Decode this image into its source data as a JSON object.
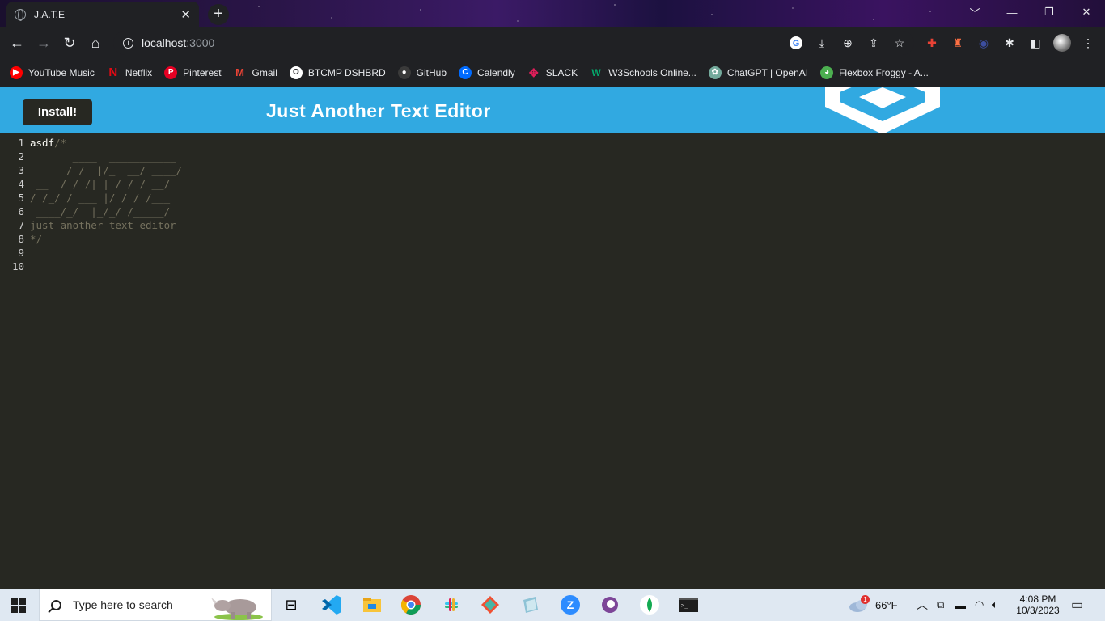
{
  "browser": {
    "tab_title": "J.A.T.E",
    "tab_close": "✕",
    "new_tab": "+",
    "url_host": "localhost",
    "url_port": ":3000",
    "window_controls": [
      "﹀",
      "—",
      "❐",
      "✕"
    ]
  },
  "bookmarks": [
    {
      "label": "YouTube Music",
      "icon": "youtube-music-icon",
      "color": "#ff0000"
    },
    {
      "label": "Netflix",
      "icon": "netflix-icon",
      "color": "#e50914"
    },
    {
      "label": "Pinterest",
      "icon": "pinterest-icon",
      "color": "#e60023"
    },
    {
      "label": "Gmail",
      "icon": "gmail-icon",
      "color": "#ea4335"
    },
    {
      "label": "BTCMP DSHBRD",
      "icon": "bootcamp-icon",
      "color": "#ffffff"
    },
    {
      "label": "GitHub",
      "icon": "github-icon",
      "color": "#24292e"
    },
    {
      "label": "Calendly",
      "icon": "calendly-icon",
      "color": "#006bff"
    },
    {
      "label": "SLACK",
      "icon": "slack-icon",
      "color": "#4a154b"
    },
    {
      "label": "W3Schools Online...",
      "icon": "w3schools-icon",
      "color": "#04aa6d"
    },
    {
      "label": "ChatGPT | OpenAI",
      "icon": "chatgpt-icon",
      "color": "#74aa9c"
    },
    {
      "label": "Flexbox Froggy - A...",
      "icon": "froggy-icon",
      "color": "#4caf50"
    }
  ],
  "app": {
    "install_label": "Install!",
    "title": "Just Another Text Editor",
    "accent": "#31a9e1"
  },
  "editor": {
    "lines": [
      {
        "n": "1",
        "plain": "asdf",
        "comment": "/*"
      },
      {
        "n": "2",
        "plain": "",
        "comment": "       ____  ___________"
      },
      {
        "n": "3",
        "plain": "",
        "comment": "      / /  |/_  __/ ____/"
      },
      {
        "n": "4",
        "plain": "",
        "comment": " __  / / /| | / / / __/"
      },
      {
        "n": "5",
        "plain": "",
        "comment": "/ /_/ / ___ |/ / / /___"
      },
      {
        "n": "6",
        "plain": "",
        "comment": " ____/_/  |_/_/ /_____/"
      },
      {
        "n": "7",
        "plain": "",
        "comment": "just another text editor"
      },
      {
        "n": "8",
        "plain": "",
        "comment": "*/"
      },
      {
        "n": "9",
        "plain": "",
        "comment": ""
      },
      {
        "n": "10",
        "plain": "",
        "comment": ""
      }
    ]
  },
  "taskbar": {
    "search_placeholder": "Type here to search",
    "weather": "66°F",
    "weather_badge": "1",
    "time": "4:08 PM",
    "date": "10/3/2023"
  }
}
